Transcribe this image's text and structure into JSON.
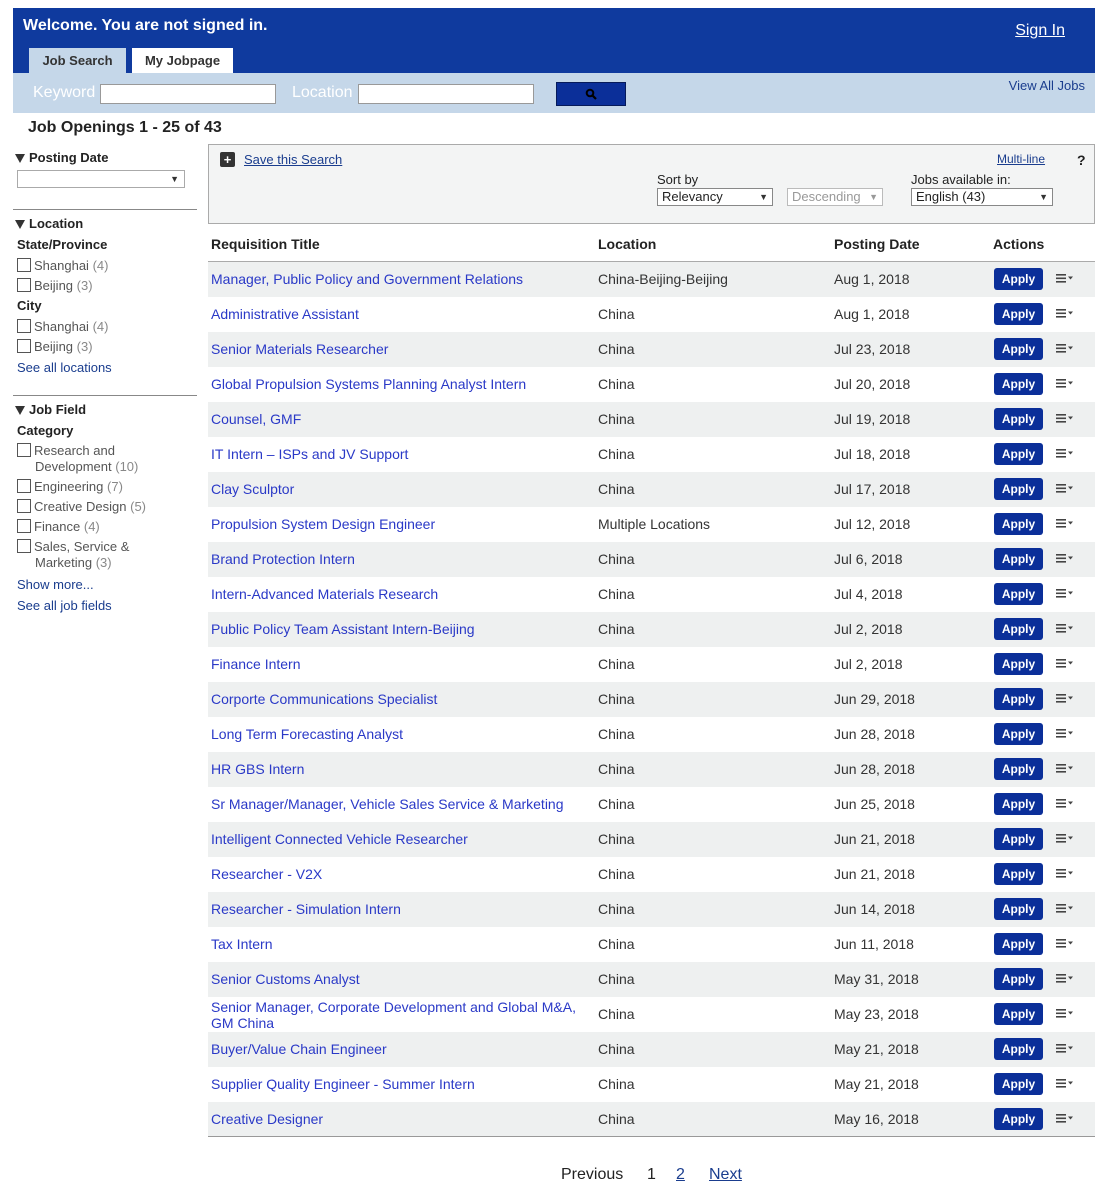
{
  "header": {
    "welcome": "Welcome. You are not signed in.",
    "sign_in": "Sign In",
    "tabs": [
      {
        "label": "Job Search",
        "active": true
      },
      {
        "label": "My Jobpage",
        "active": false
      }
    ]
  },
  "search": {
    "keyword_label": "Keyword",
    "keyword_value": "",
    "location_label": "Location",
    "location_value": "",
    "button_icon": "search-icon",
    "view_all": "View All Jobs"
  },
  "results_heading": "Job Openings 1 - 25 of 43",
  "sidebar": {
    "posting_date": {
      "title": "Posting Date",
      "selected": ""
    },
    "location": {
      "title": "Location",
      "state_label": "State/Province",
      "states": [
        {
          "name": "Shanghai",
          "count": "(4)"
        },
        {
          "name": "Beijing",
          "count": "(3)"
        }
      ],
      "city_label": "City",
      "cities": [
        {
          "name": "Shanghai",
          "count": "(4)"
        },
        {
          "name": "Beijing",
          "count": "(3)"
        }
      ],
      "see_all": "See all locations"
    },
    "job_field": {
      "title": "Job Field",
      "category_label": "Category",
      "categories": [
        {
          "name": "Research and",
          "name2": "Development",
          "count": "(10)"
        },
        {
          "name": "Engineering",
          "name2": "",
          "count": "(7)"
        },
        {
          "name": "Creative Design",
          "name2": "",
          "count": "(5)"
        },
        {
          "name": "Finance",
          "name2": "",
          "count": "(4)"
        },
        {
          "name": "Sales, Service &",
          "name2": "Marketing",
          "count": "(3)"
        }
      ],
      "show_more": "Show more...",
      "see_all": "See all job fields"
    }
  },
  "toolbar": {
    "save_search": "Save this Search",
    "multi_line": "Multi-line",
    "help": "?",
    "sort_by_label": "Sort by",
    "sort_by_value": "Relevancy",
    "order_value": "Descending",
    "jobs_available_label": "Jobs available in:",
    "language_value": "English (43)"
  },
  "table": {
    "headers": {
      "title": "Requisition Title",
      "location": "Location",
      "date": "Posting Date",
      "actions": "Actions"
    },
    "apply_label": "Apply",
    "rows": [
      {
        "title": "Manager, Public Policy and Government Relations",
        "location": "China-Beijing-Beijing",
        "date": "Aug 1, 2018"
      },
      {
        "title": "Administrative Assistant",
        "location": "China",
        "date": "Aug 1, 2018"
      },
      {
        "title": "Senior Materials Researcher",
        "location": "China",
        "date": "Jul 23, 2018"
      },
      {
        "title": "Global Propulsion Systems Planning Analyst Intern",
        "location": "China",
        "date": "Jul 20, 2018"
      },
      {
        "title": "Counsel, GMF",
        "location": "China",
        "date": "Jul 19, 2018"
      },
      {
        "title": "IT Intern – ISPs and JV Support",
        "location": "China",
        "date": "Jul 18, 2018"
      },
      {
        "title": "Clay Sculptor",
        "location": "China",
        "date": "Jul 17, 2018"
      },
      {
        "title": "Propulsion System Design Engineer",
        "location": "Multiple Locations",
        "date": "Jul 12, 2018"
      },
      {
        "title": "Brand Protection Intern",
        "location": "China",
        "date": "Jul 6, 2018"
      },
      {
        "title": "Intern-Advanced Materials Research",
        "location": "China",
        "date": "Jul 4, 2018"
      },
      {
        "title": "Public Policy Team Assistant Intern-Beijing",
        "location": "China",
        "date": "Jul 2, 2018"
      },
      {
        "title": "Finance Intern",
        "location": "China",
        "date": "Jul 2, 2018"
      },
      {
        "title": "Corporte Communications Specialist",
        "location": "China",
        "date": "Jun 29, 2018"
      },
      {
        "title": "Long Term Forecasting Analyst",
        "location": "China",
        "date": "Jun 28, 2018"
      },
      {
        "title": "HR GBS Intern",
        "location": "China",
        "date": "Jun 28, 2018"
      },
      {
        "title": "Sr Manager/Manager, Vehicle Sales Service & Marketing",
        "location": "China",
        "date": "Jun 25, 2018"
      },
      {
        "title": "Intelligent Connected Vehicle Researcher",
        "location": "China",
        "date": "Jun 21, 2018"
      },
      {
        "title": "Researcher - V2X",
        "location": "China",
        "date": "Jun 21, 2018"
      },
      {
        "title": "Researcher - Simulation Intern",
        "location": "China",
        "date": "Jun 14, 2018"
      },
      {
        "title": "Tax Intern",
        "location": "China",
        "date": "Jun 11, 2018"
      },
      {
        "title": "Senior Customs Analyst",
        "location": "China",
        "date": "May 31, 2018"
      },
      {
        "title": "Senior Manager, Corporate Development and Global M&A, GM China",
        "location": "China",
        "date": "May 23, 2018"
      },
      {
        "title": "Buyer/Value Chain Engineer",
        "location": "China",
        "date": "May 21, 2018"
      },
      {
        "title": "Supplier Quality Engineer - Summer Intern",
        "location": "China",
        "date": "May 21, 2018"
      },
      {
        "title": "Creative Designer",
        "location": "China",
        "date": "May 16, 2018"
      }
    ]
  },
  "pagination": {
    "previous": "Previous",
    "pages": [
      "1",
      "2"
    ],
    "current": "1",
    "next": "Next"
  },
  "colors": {
    "header_blue": "#0f3a9e",
    "search_bar": "#c5d7e9",
    "link_blue": "#2a39c7",
    "button_blue": "#0b2f99"
  }
}
